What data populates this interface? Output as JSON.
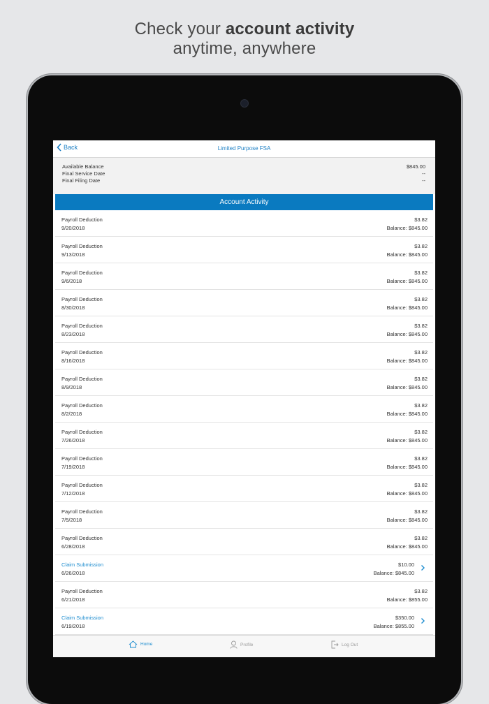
{
  "headline": {
    "prefix": "Check your ",
    "bold": "account activity",
    "line2": "anytime, anywhere"
  },
  "navbar": {
    "back_label": "Back",
    "title": "Limited Purpose FSA"
  },
  "summary": {
    "rows": [
      {
        "label": "Available Balance",
        "value": "$845.00"
      },
      {
        "label": "Final Service Date",
        "value": "--"
      },
      {
        "label": "Final Filing Date",
        "value": "--"
      }
    ]
  },
  "section_header": "Account Activity",
  "activity": [
    {
      "title": "Payroll Deduction",
      "date": "9/20/2018",
      "amount": "$3.82",
      "balance": "Balance: $845.00",
      "link": false
    },
    {
      "title": "Payroll Deduction",
      "date": "9/13/2018",
      "amount": "$3.82",
      "balance": "Balance: $845.00",
      "link": false
    },
    {
      "title": "Payroll Deduction",
      "date": "9/6/2018",
      "amount": "$3.82",
      "balance": "Balance: $845.00",
      "link": false
    },
    {
      "title": "Payroll Deduction",
      "date": "8/30/2018",
      "amount": "$3.82",
      "balance": "Balance: $845.00",
      "link": false
    },
    {
      "title": "Payroll Deduction",
      "date": "8/23/2018",
      "amount": "$3.82",
      "balance": "Balance: $845.00",
      "link": false
    },
    {
      "title": "Payroll Deduction",
      "date": "8/16/2018",
      "amount": "$3.82",
      "balance": "Balance: $845.00",
      "link": false
    },
    {
      "title": "Payroll Deduction",
      "date": "8/9/2018",
      "amount": "$3.82",
      "balance": "Balance: $845.00",
      "link": false
    },
    {
      "title": "Payroll Deduction",
      "date": "8/2/2018",
      "amount": "$3.82",
      "balance": "Balance: $845.00",
      "link": false
    },
    {
      "title": "Payroll Deduction",
      "date": "7/26/2018",
      "amount": "$3.82",
      "balance": "Balance: $845.00",
      "link": false
    },
    {
      "title": "Payroll Deduction",
      "date": "7/19/2018",
      "amount": "$3.82",
      "balance": "Balance: $845.00",
      "link": false
    },
    {
      "title": "Payroll Deduction",
      "date": "7/12/2018",
      "amount": "$3.82",
      "balance": "Balance: $845.00",
      "link": false
    },
    {
      "title": "Payroll Deduction",
      "date": "7/5/2018",
      "amount": "$3.82",
      "balance": "Balance: $845.00",
      "link": false
    },
    {
      "title": "Payroll Deduction",
      "date": "6/28/2018",
      "amount": "$3.82",
      "balance": "Balance: $845.00",
      "link": false
    },
    {
      "title": "Claim Submission",
      "date": "6/26/2018",
      "amount": "$10.00",
      "balance": "Balance: $845.00",
      "link": true
    },
    {
      "title": "Payroll Deduction",
      "date": "6/21/2018",
      "amount": "$3.82",
      "balance": "Balance: $855.00",
      "link": false
    },
    {
      "title": "Claim Submission",
      "date": "6/19/2018",
      "amount": "$350.00",
      "balance": "Balance: $855.00",
      "link": true
    }
  ],
  "tabbar": {
    "items": [
      {
        "label": "Home",
        "icon": "home-icon",
        "active": true
      },
      {
        "label": "Profile",
        "icon": "profile-icon",
        "active": false
      },
      {
        "label": "Log Out",
        "icon": "logout-icon",
        "active": false
      }
    ]
  },
  "colors": {
    "accent": "#0a7ac0",
    "link": "#1c8ccf",
    "background": "#e6e7e9"
  }
}
